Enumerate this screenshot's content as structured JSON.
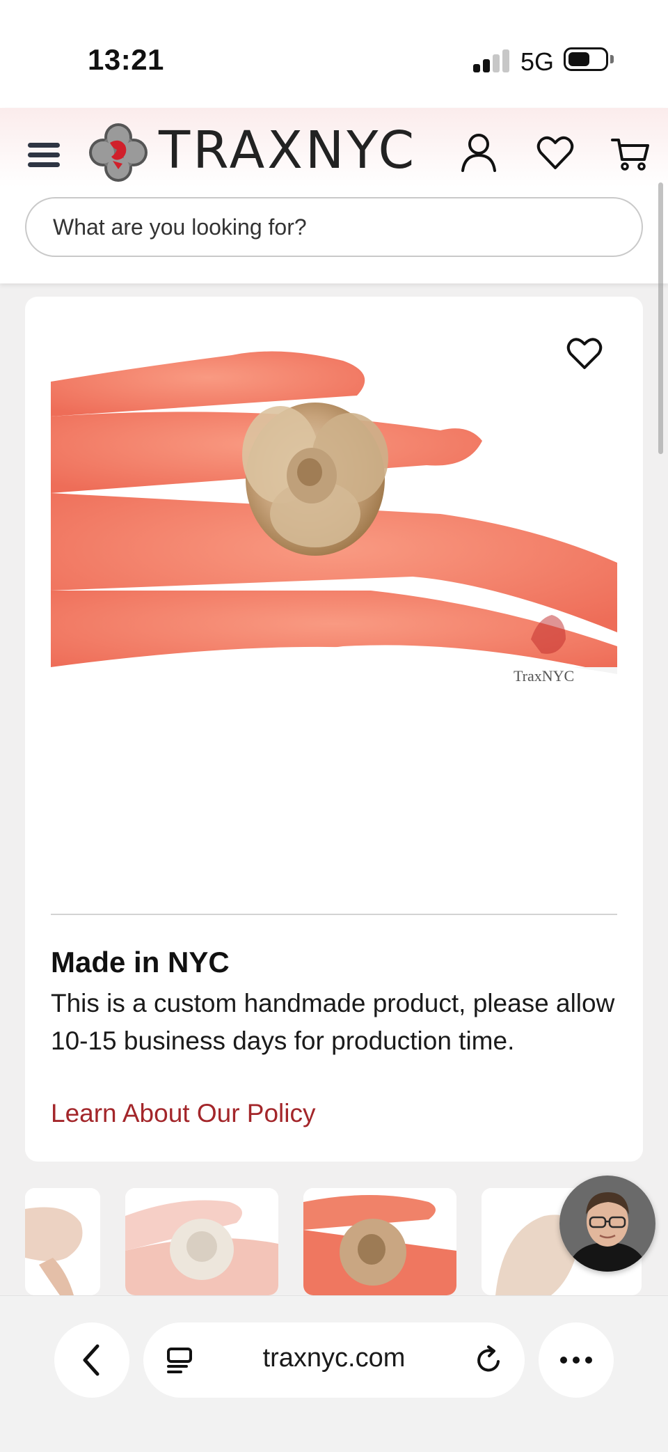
{
  "status_bar": {
    "time": "13:21",
    "network": "5G"
  },
  "header": {
    "brand": "TRAXNYC",
    "search_placeholder": "What are you looking for?",
    "icons": [
      "menu-icon",
      "account-icon",
      "heart-icon",
      "cart-icon"
    ]
  },
  "product": {
    "made_title": "Made in NYC",
    "made_description": "This is a custom handmade product, please allow 10-15 business days for production time.",
    "policy_link": "Learn About Our Policy",
    "watermark": "TraxNYC"
  },
  "browser": {
    "url": "traxnyc.com"
  },
  "colors": {
    "link": "#a3262a",
    "brand_red": "#d0202b",
    "skin": "#f2806a"
  }
}
